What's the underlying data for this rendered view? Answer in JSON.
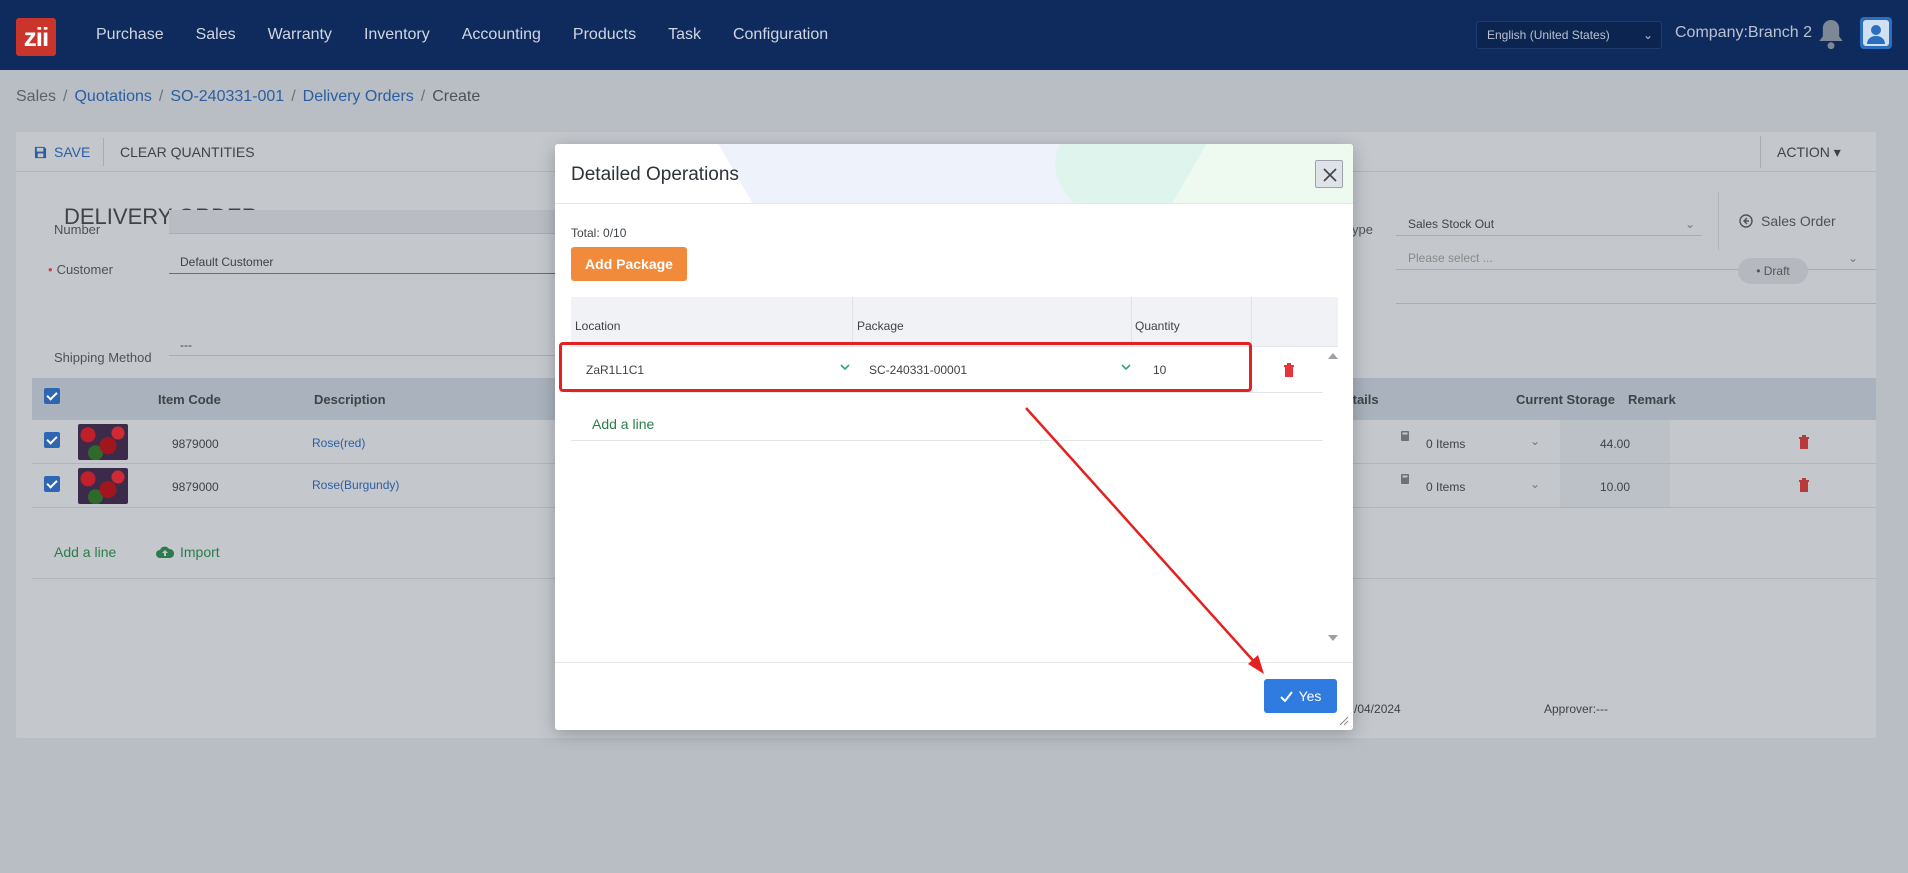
{
  "nav": {
    "logo": "zii",
    "items": [
      "Purchase",
      "Sales",
      "Warranty",
      "Inventory",
      "Accounting",
      "Products",
      "Task",
      "Configuration"
    ],
    "language": "English (United States)",
    "company": "Company:Branch 2"
  },
  "breadcrumb": [
    "Sales",
    "Quotations",
    "SO-240331-001",
    "Delivery Orders",
    "Create"
  ],
  "toolbar": {
    "save": "SAVE",
    "clear": "CLEAR QUANTITIES",
    "action": "ACTION"
  },
  "form": {
    "title": "DELIVERY ORDER",
    "smart_button": "Sales Order",
    "labels": {
      "number": "Number",
      "customer": "Customer",
      "shipping": "Shipping Method",
      "type_partial": "ype"
    },
    "values": {
      "customer": "Default Customer",
      "shipping": "---",
      "type": "Sales Stock Out",
      "select_placeholder": "Please select ..."
    },
    "status": "Draft",
    "columns": {
      "item_code": "Item Code",
      "description": "Description",
      "details": "Details",
      "current_storage": "Current Storage",
      "remark": "Remark"
    },
    "rows": [
      {
        "code": "9879000",
        "description": "Rose(red)",
        "details": "0 Items",
        "storage": "44.00"
      },
      {
        "code": "9879000",
        "description": "Rose(Burgundy)",
        "details": "0 Items",
        "storage": "10.00"
      }
    ],
    "add_line": "Add a line",
    "import": "Import",
    "footer_date": "/04/2024",
    "approver": "Approver:---"
  },
  "modal": {
    "title": "Detailed Operations",
    "total": "Total: 0/10",
    "add_package": "Add Package",
    "columns": {
      "location": "Location",
      "package": "Package",
      "quantity": "Quantity"
    },
    "row": {
      "location": "ZaR1L1C1",
      "package": "SC-240331-00001",
      "quantity": "10"
    },
    "add_line": "Add a line",
    "yes": "Yes"
  },
  "colors": {
    "nav_bg": "#0f2a5c",
    "accent_blue": "#2f7be0",
    "accent_orange": "#f28a3c",
    "accent_green": "#2a7c4c",
    "highlight_red": "#e5211f"
  }
}
